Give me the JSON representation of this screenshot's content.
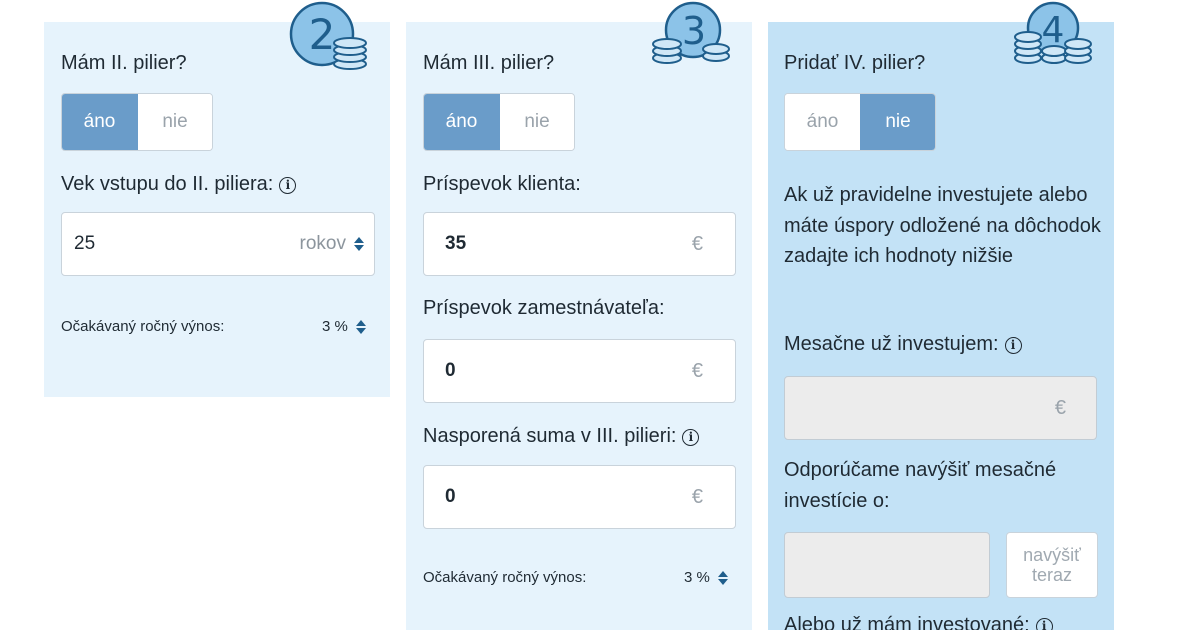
{
  "pillar2": {
    "step": "2",
    "question": "Mám II. pilier?",
    "yes": "áno",
    "no": "nie",
    "entry_age_label": "Vek vstupu do II. piliera:",
    "entry_age_value": "25",
    "entry_age_unit": "rokov",
    "return_label": "Očakávaný ročný výnos:",
    "return_value": "3 %"
  },
  "pillar3": {
    "step": "3",
    "question": "Mám III. pilier?",
    "yes": "áno",
    "no": "nie",
    "client_label": "Príspevok klienta:",
    "client_value": "35",
    "employer_label": "Príspevok zamestnávateľa:",
    "employer_value": "0",
    "saved_label": "Nasporená suma v III. pilieri:",
    "saved_value": "0",
    "currency": "€",
    "return_label": "Očakávaný ročný výnos:",
    "return_value": "3 %"
  },
  "pillar4": {
    "step": "4",
    "question": "Pridať IV. pilier?",
    "yes": "áno",
    "no": "nie",
    "info_text": "Ak už pravidelne investujete alebo máte úspory odložené na dôchodok zadajte ich hodnoty nižšie",
    "monthly_label": "Mesačne už investujem:",
    "monthly_value": "",
    "currency": "€",
    "recommend_label": "Odporúčame navýšiť mesačné investície o:",
    "recommend_value": "",
    "increase_button": "navýšiť teraz",
    "invested_label": "Alebo už mám investované:"
  },
  "colors": {
    "panel_light": "#e6f3fc",
    "panel_active": "#c3e2f6",
    "toggle_active": "#6a9cc9",
    "badge_blue": "#1f5e8c"
  },
  "icons": {
    "badge": "numbered-coin-stack-icon",
    "info": "info-circle-icon",
    "spinner": "up-down-spinner-icon"
  }
}
